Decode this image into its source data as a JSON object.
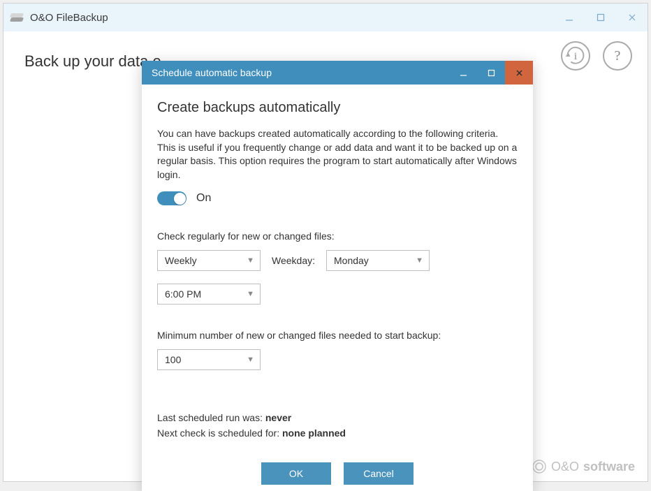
{
  "app": {
    "title": "O&O FileBackup"
  },
  "page": {
    "heading": "Back up your data e"
  },
  "footer": {
    "brand_prefix": "O&O",
    "brand_suffix": "software"
  },
  "dialog": {
    "title": "Schedule automatic backup",
    "heading": "Create backups automatically",
    "description": "You can have backups created automatically according to the following criteria. This is useful if you frequently change or add data and want it to be backed up on a regular basis. This option requires the program to start automatically after Windows login.",
    "toggle_label": "On",
    "check_label": "Check regularly for new or changed files:",
    "frequency": "Weekly",
    "weekday_label": "Weekday:",
    "weekday": "Monday",
    "time": "6:00 PM",
    "min_files_label": "Minimum number of new or changed files needed to start backup:",
    "min_files": "100",
    "last_run_label": "Last scheduled run was: ",
    "last_run_value": "never",
    "next_check_label": "Next check is scheduled for: ",
    "next_check_value": "none planned",
    "ok": "OK",
    "cancel": "Cancel"
  }
}
